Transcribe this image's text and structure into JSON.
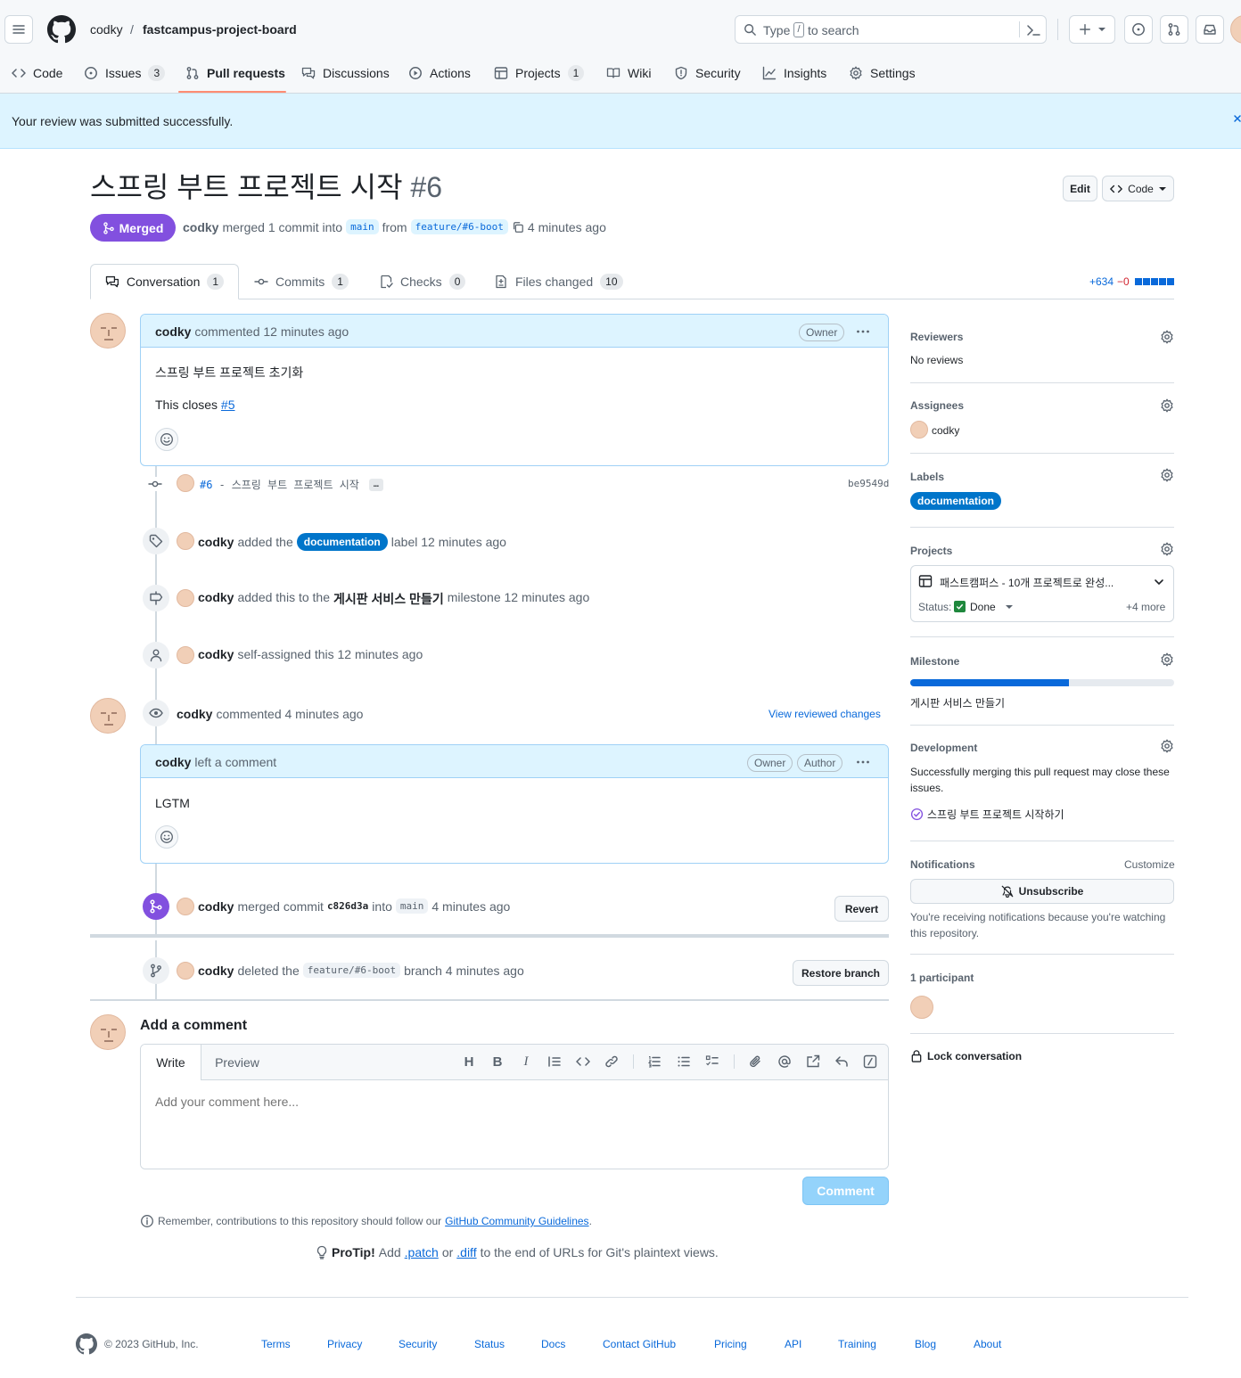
{
  "header": {
    "owner": "codky",
    "separator": "/",
    "repo": "fastcampus-project-board",
    "search_type": "Type",
    "search_key": "/",
    "search_rest": "to search"
  },
  "repo_nav": {
    "code": "Code",
    "issues": "Issues",
    "issues_count": "3",
    "pulls": "Pull requests",
    "discussions": "Discussions",
    "actions": "Actions",
    "projects": "Projects",
    "projects_count": "1",
    "wiki": "Wiki",
    "security": "Security",
    "insights": "Insights",
    "settings": "Settings"
  },
  "flash": {
    "message": "Your review was submitted successfully."
  },
  "pr": {
    "title": "스프링 부트 프로젝트 시작",
    "number": "#6",
    "edit_label": "Edit",
    "code_label": "Code",
    "state": "Merged",
    "author": "codky",
    "merged_text": "merged 1 commit into",
    "base_branch": "main",
    "from_text": "from",
    "head_branch": "feature/#6-boot",
    "time": "4 minutes ago"
  },
  "tabs": {
    "conversation": "Conversation",
    "conversation_count": "1",
    "commits": "Commits",
    "commits_count": "1",
    "checks": "Checks",
    "checks_count": "0",
    "files": "Files changed",
    "files_count": "10",
    "additions": "+634",
    "deletions": "−0"
  },
  "timeline": {
    "comment1": {
      "author": "codky",
      "action": "commented 12 minutes ago",
      "badge": "Owner",
      "body_line1": "스프링 부트 프로젝트 초기화",
      "body_closes": "This closes",
      "body_link": "#5"
    },
    "commit": {
      "ref": "#6",
      "dash": "-",
      "message": "스프링 부트 프로젝트 시작",
      "ellipsis": "…",
      "sha": "be9549d"
    },
    "label_event": {
      "author": "codky",
      "pre": "added the",
      "label": "documentation",
      "post": "label 12 minutes ago"
    },
    "milestone_event": {
      "author": "codky",
      "pre": "added this to the",
      "milestone": "게시판 서비스 만들기",
      "post": "milestone 12 minutes ago"
    },
    "assign_event": {
      "author": "codky",
      "text": "self-assigned this 12 minutes ago"
    },
    "review": {
      "author": "codky",
      "action": "commented 4 minutes ago",
      "view_link": "View reviewed changes"
    },
    "review_comment": {
      "author": "codky",
      "action": "left a comment",
      "badge1": "Owner",
      "badge2": "Author",
      "body": "LGTM"
    },
    "merge_event": {
      "author": "codky",
      "pre": "merged commit",
      "sha": "c826d3a",
      "mid": "into",
      "branch": "main",
      "post": "4 minutes ago",
      "button": "Revert"
    },
    "delete_event": {
      "author": "codky",
      "pre": "deleted the",
      "branch": "feature/#6-boot",
      "post": "branch 4 minutes ago",
      "button": "Restore branch"
    }
  },
  "comment_box": {
    "heading": "Add a comment",
    "tab_write": "Write",
    "tab_preview": "Preview",
    "placeholder": "Add your comment here...",
    "submit": "Comment",
    "guidelines_pre": "Remember, contributions to this repository should follow our",
    "guidelines_link": "GitHub Community Guidelines",
    "guidelines_post": "."
  },
  "protip": {
    "label": "ProTip!",
    "pre": "Add",
    "patch": ".patch",
    "or": "or",
    "diff": ".diff",
    "post": "to the end of URLs for Git's plaintext views."
  },
  "sidebar": {
    "reviewers": {
      "title": "Reviewers",
      "value": "No reviews"
    },
    "assignees": {
      "title": "Assignees",
      "value": "codky"
    },
    "labels": {
      "title": "Labels",
      "value": "documentation"
    },
    "projects": {
      "title": "Projects",
      "name": "패스트캠퍼스 - 10개 프로젝트로 완성...",
      "status_label": "Status:",
      "status_value": "Done",
      "more": "+4 more"
    },
    "milestone": {
      "title": "Milestone",
      "name": "게시판 서비스 만들기",
      "progress": 0.6
    },
    "development": {
      "title": "Development",
      "note": "Successfully merging this pull request may close these issues.",
      "issue": "스프링 부트 프로젝트 시작하기"
    },
    "notifications": {
      "title": "Notifications",
      "customize": "Customize",
      "button": "Unsubscribe",
      "note": "You're receiving notifications because you're watching this repository."
    },
    "participants": {
      "title": "1 participant"
    },
    "lock": "Lock conversation"
  },
  "footer": {
    "copyright": "© 2023 GitHub, Inc.",
    "links": [
      "Terms",
      "Privacy",
      "Security",
      "Status",
      "Docs",
      "Contact GitHub",
      "Pricing",
      "API",
      "Training",
      "Blog",
      "About"
    ]
  },
  "colors": {
    "accent": "#0969da",
    "merged": "#8250df",
    "flash_bg": "#ddf4ff",
    "label": "#0075ca",
    "success": "#1f883d"
  }
}
